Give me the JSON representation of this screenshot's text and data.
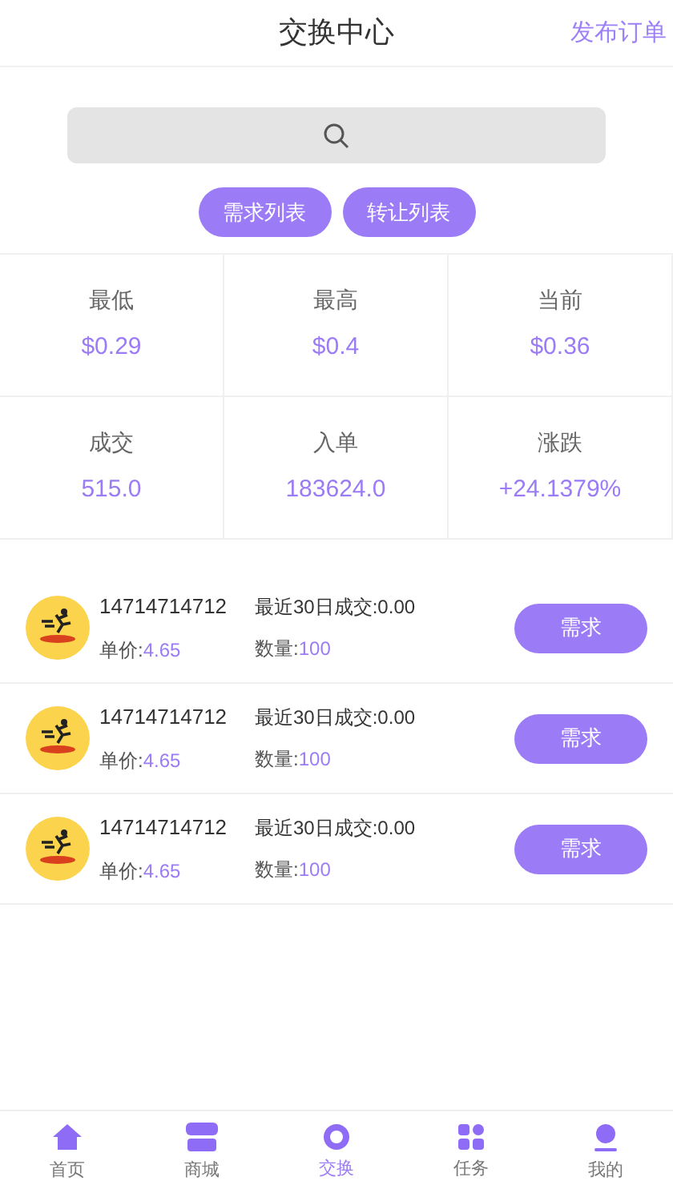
{
  "header": {
    "title": "交换中心",
    "action": "发布订单"
  },
  "tabs": [
    {
      "label": "需求列表"
    },
    {
      "label": "转让列表"
    }
  ],
  "stats": [
    {
      "label": "最低",
      "value": "$0.29"
    },
    {
      "label": "最高",
      "value": "$0.4"
    },
    {
      "label": "当前",
      "value": "$0.36"
    },
    {
      "label": "成交",
      "value": "515.0"
    },
    {
      "label": "入单",
      "value": "183624.0"
    },
    {
      "label": "涨跌",
      "value": "+24.1379%"
    }
  ],
  "orders": [
    {
      "user": "14714714712",
      "recent": "最近30日成交:0.00",
      "price_label": "单价:",
      "price": "4.65",
      "qty_label": "数量:",
      "qty": "100",
      "button": "需求"
    },
    {
      "user": "14714714712",
      "recent": "最近30日成交:0.00",
      "price_label": "单价:",
      "price": "4.65",
      "qty_label": "数量:",
      "qty": "100",
      "button": "需求"
    },
    {
      "user": "14714714712",
      "recent": "最近30日成交:0.00",
      "price_label": "单价:",
      "price": "4.65",
      "qty_label": "数量:",
      "qty": "100",
      "button": "需求"
    }
  ],
  "nav": [
    {
      "kind": "home",
      "label": "首页",
      "selected": false
    },
    {
      "kind": "shop",
      "label": "商城",
      "selected": false
    },
    {
      "kind": "exchange",
      "label": "交换",
      "selected": true
    },
    {
      "kind": "tasks",
      "label": "任务",
      "selected": false
    },
    {
      "kind": "profile",
      "label": "我的",
      "selected": false
    }
  ]
}
